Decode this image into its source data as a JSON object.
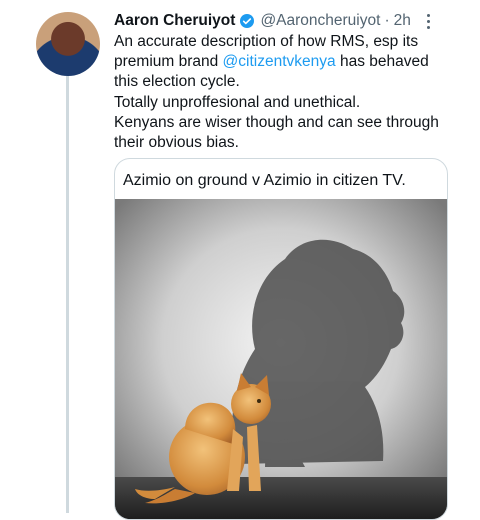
{
  "tweet": {
    "author_name": "Aaron Cheruiyot",
    "handle": "@Aaroncheruiyot",
    "separator": "·",
    "time": "2h",
    "verified_icon": "verified-badge-icon",
    "more_icon": "more-options-icon",
    "lines": {
      "l1": "An accurate description of how RMS, esp its",
      "l2_pre": "premium brand ",
      "l2_mention": "@citizentvkenya",
      "l2_post": " has behaved",
      "l3": "this election cycle.",
      "l4": "Totally unproffesional and unethical.",
      "l5": "Kenyans are wiser though and can see through",
      "l6": "their obvious bias."
    },
    "media_caption": "Azimio on ground v Azimio in citizen TV."
  },
  "colors": {
    "link": "#1d9bf0",
    "secondary_text": "#536471",
    "border": "#cfd9de"
  }
}
